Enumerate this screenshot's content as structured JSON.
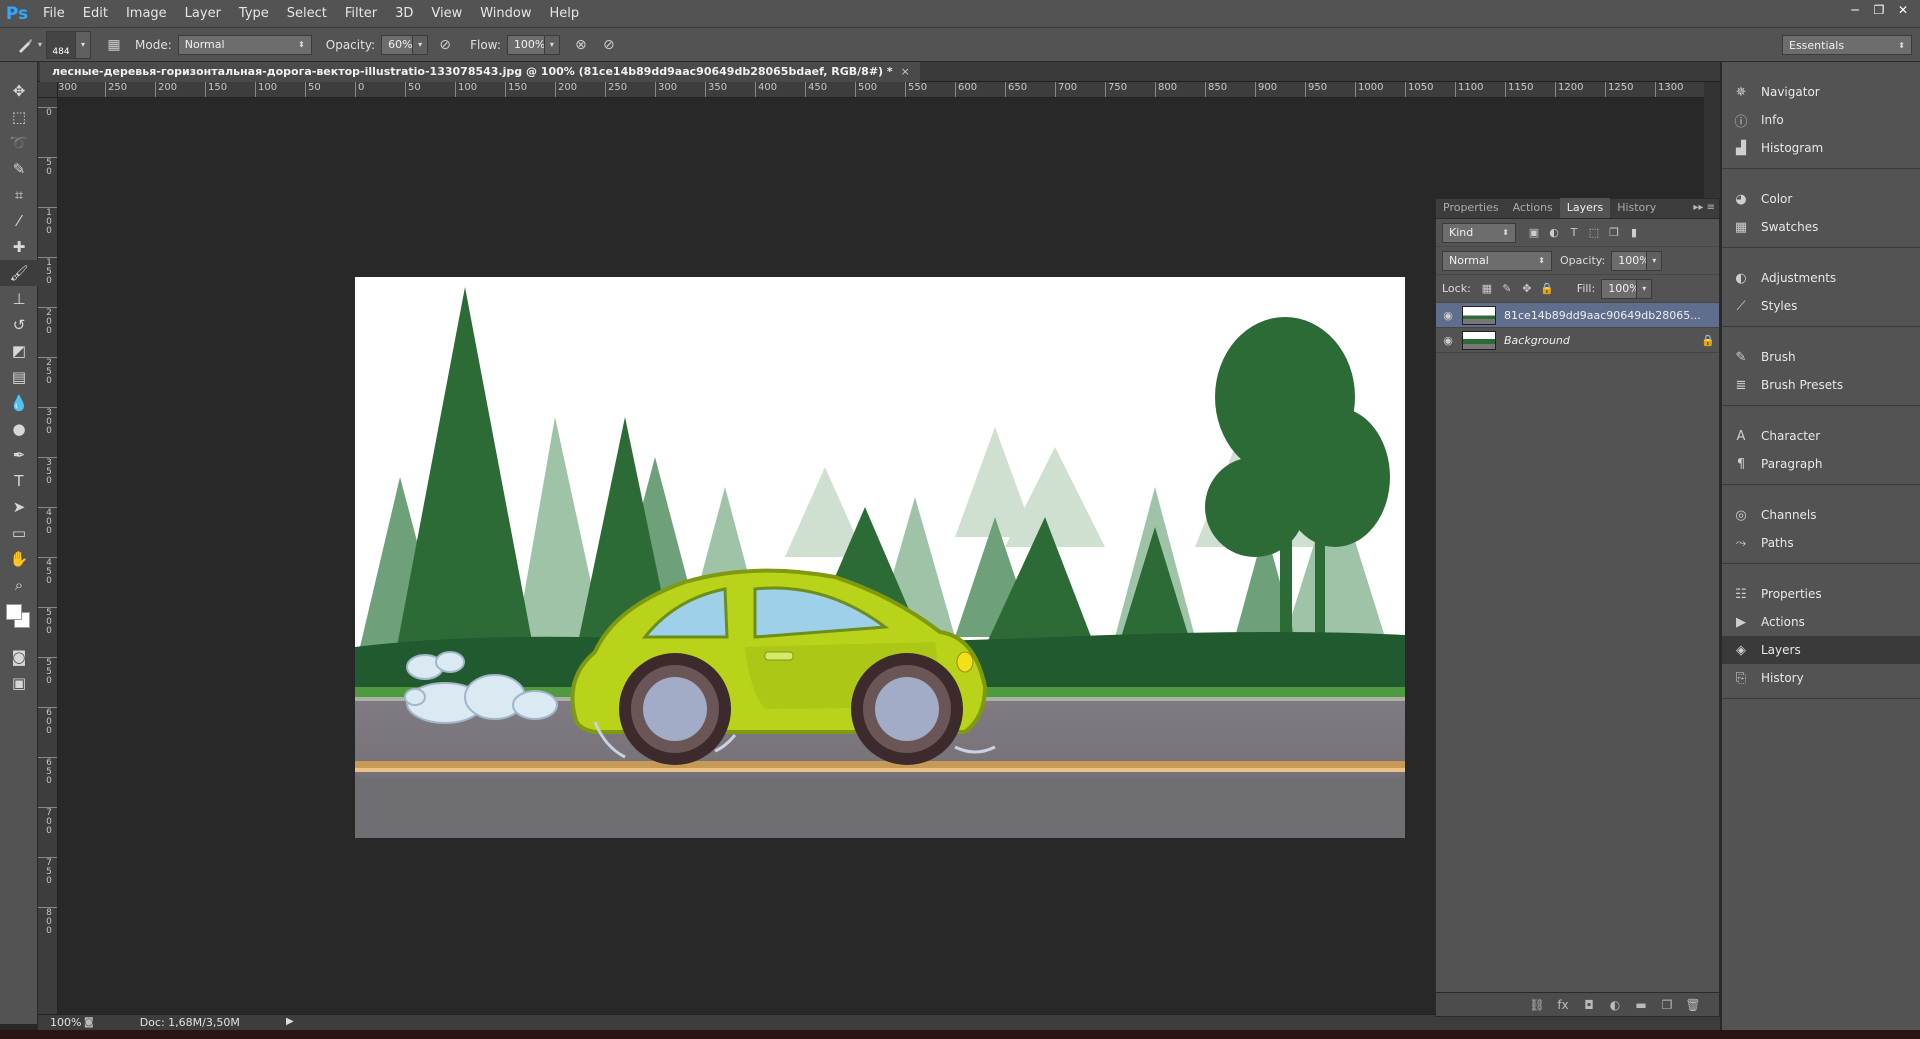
{
  "app": {
    "logo": "Ps"
  },
  "menu": [
    "File",
    "Edit",
    "Image",
    "Layer",
    "Type",
    "Select",
    "Filter",
    "3D",
    "View",
    "Window",
    "Help"
  ],
  "window_controls": [
    "─",
    "❐",
    "✕"
  ],
  "options": {
    "brush_size": "484",
    "mode_label": "Mode:",
    "mode_value": "Normal",
    "opacity_label": "Opacity:",
    "opacity_value": "60%",
    "flow_label": "Flow:",
    "flow_value": "100%",
    "workspace": "Essentials"
  },
  "document": {
    "tab_title": "лесные-деревья-горизонтальная-дорога-вектор-illustratio-133078543.jpg @ 100% (81ce14b89dd9aac90649db28065bdaef, RGB/8#) *",
    "close": "×"
  },
  "ruler_h": [
    "300",
    "250",
    "200",
    "150",
    "100",
    "50",
    "0",
    "50",
    "100",
    "150",
    "200",
    "250",
    "300",
    "350",
    "400",
    "450",
    "500",
    "550",
    "600",
    "650",
    "700",
    "750",
    "800",
    "850",
    "900",
    "950",
    "1000",
    "1050",
    "1100",
    "1150",
    "1200",
    "1250",
    "1300"
  ],
  "ruler_v": [
    "0",
    "50",
    "100",
    "150",
    "200",
    "250",
    "300",
    "350",
    "400",
    "450",
    "500",
    "550",
    "600",
    "650",
    "700",
    "750",
    "800"
  ],
  "status": {
    "zoom": "100%",
    "doc": "Doc: 1,68M/3,50M",
    "arrow": "▶"
  },
  "layers_panel": {
    "tabs": [
      "Properties",
      "Actions",
      "Layers",
      "History"
    ],
    "active_tab": "Layers",
    "menu": "▸▸ ≡",
    "filter_kind": "Kind",
    "blend_mode": "Normal",
    "opacity_label": "Opacity:",
    "opacity_value": "100%",
    "lock_label": "Lock:",
    "fill_label": "Fill:",
    "fill_value": "100%",
    "layers": [
      {
        "name": "81ce14b89dd9aac90649db28065...",
        "selected": true,
        "locked": false
      },
      {
        "name": "Background",
        "selected": false,
        "locked": true
      }
    ]
  },
  "dock": [
    [
      "Navigator",
      "Info",
      "Histogram"
    ],
    [
      "Color",
      "Swatches"
    ],
    [
      "Adjustments",
      "Styles"
    ],
    [
      "Brush",
      "Brush Presets"
    ],
    [
      "Character",
      "Paragraph"
    ],
    [
      "Channels",
      "Paths"
    ],
    [
      "Properties",
      "Actions",
      "Layers",
      "History"
    ]
  ],
  "dock_active": "Layers"
}
